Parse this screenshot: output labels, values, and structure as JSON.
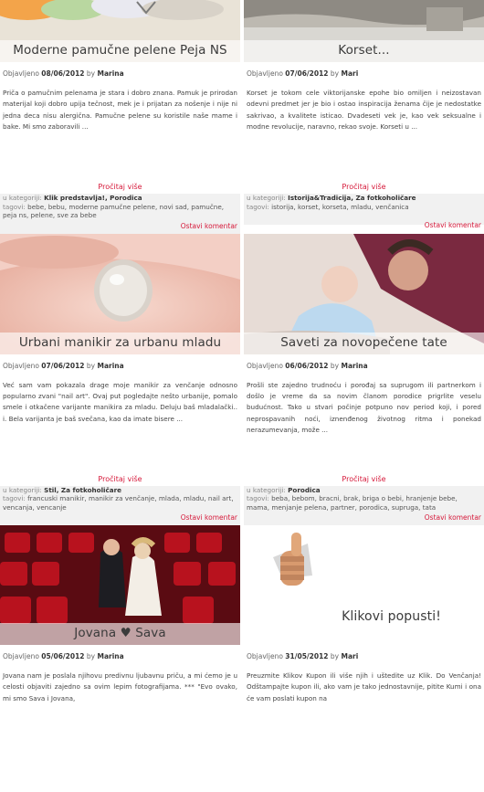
{
  "posts": [
    {
      "title": "Moderne pamučne pelene Peja NS",
      "meta_prefix": "Objavljeno",
      "date": "08/06/2012",
      "by": "by",
      "author": "Marina",
      "excerpt": "Priča o pamučnim pelenama je stara i dobro znana. Pamuk je prirodan materijal koji dobro upija tečnost, mek je i prijatan za nošenje i nije ni jedna deca nisu alergična. Pamučne pelene su koristile naše mame i bake. Mi smo zaboravili ...",
      "read_more": "Pročitaj više",
      "cat_label": "u kategoriji:",
      "categories": "Klik predstavlja!, Porodica",
      "tags_label": "tagovi:",
      "tags": "bebe, bebu, moderne pamučne pelene, novi sad, pamučne, peja ns, pelene, sve za bebe",
      "comment": "Ostavi komentar"
    },
    {
      "title": "Korset...",
      "meta_prefix": "Objavljeno",
      "date": "07/06/2012",
      "by": "by",
      "author": "Mari",
      "excerpt": "Korset je tokom cele viktorijanske epohe bio omiljen i neizostavan odevni predmet jer je bio i ostao inspiracija ženama čije je nedostatke sakrivao, a kvalitete isticao. Dvadeseti vek je, kao vek seksualne i modne revolucije, naravno, rekao svoje. Korseti u ...",
      "read_more": "Pročitaj više",
      "cat_label": "u kategoriji:",
      "categories": "Istorija&Tradicija, Za fotkoholičare",
      "tags_label": "tagovi:",
      "tags": "istorija, korset, korseta, mladu, venčanica",
      "comment": "Ostavi komentar"
    },
    {
      "title": "Urbani manikir za urbanu mladu",
      "meta_prefix": "Objavljeno",
      "date": "07/06/2012",
      "by": "by",
      "author": "Marina",
      "excerpt": "Već sam vam pokazala drage moje manikir za venčanje odnosno popularno zvani \"nail art\". Ovaj put pogledajte nešto urbanije, pomalo smele i otkačene varijante manikira za mladu. Deluju baš mladalački.. i. Bela varijanta je baš svečana, kao da imate bisere ...",
      "read_more": "Pročitaj više",
      "cat_label": "u kategoriji:",
      "categories": "Stil, Za fotkoholičare",
      "tags_label": "tagovi:",
      "tags": "francuski manikir, manikir za venčanje, mlada, mladu, nail art, vencanja, vencanje",
      "comment": "Ostavi komentar"
    },
    {
      "title": "Saveti za novopečene tate",
      "meta_prefix": "Objavljeno",
      "date": "06/06/2012",
      "by": "by",
      "author": "Marina",
      "excerpt": "Prošli ste zajedno trudnoću i porođaj sa suprugom ili partnerkom i došlo je vreme da sa novim članom porodice prigrlite veselu budućnost. Tako u stvari počinje potpuno nov period koji, i pored neprospavanih noći, iznenđenog životnog ritma i ponekad nerazumevanja, može ...",
      "read_more": "Pročitaj više",
      "cat_label": "u kategoriji:",
      "categories": "Porodica",
      "tags_label": "tagovi:",
      "tags": "beba, bebom, bracni, brak, briga o bebi, hranjenje bebe, mama, menjanje pelena, partner, porodica, supruga, tata",
      "comment": "Ostavi komentar"
    },
    {
      "title": "Jovana ♥ Sava",
      "meta_prefix": "Objavljeno",
      "date": "05/06/2012",
      "by": "by",
      "author": "Marina",
      "excerpt": "Jovana nam je poslala njihovu predivnu ljubavnu priču, a mi ćemo je u celosti objaviti zajedno sa ovim lepim fotografijama. *** \"Evo ovako, mi smo Sava i Jovana,"
    },
    {
      "title": "Klikovi popusti!",
      "meta_prefix": "Objavljeno",
      "date": "31/05/2012",
      "by": "by",
      "author": "Mari",
      "excerpt": "Preuzmite Klikov Kupon ili više njih i uštedite uz Klik. Do Venčanja! Odštampajte kupon ili, ako vam je tako jednostavnije, pitite Kumi i ona će vam poslati kupon na"
    }
  ],
  "colors": {
    "accent": "#d6193a",
    "meta_bg": "#f1f1f1"
  }
}
